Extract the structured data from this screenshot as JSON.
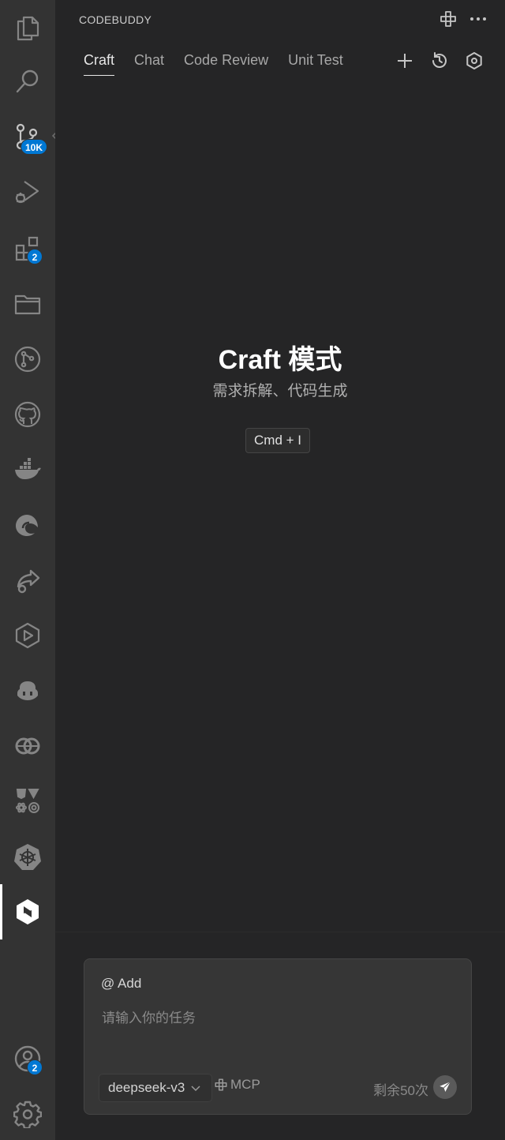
{
  "activity_bar": {
    "items": [
      {
        "name": "explorer",
        "icon": "files-icon"
      },
      {
        "name": "search",
        "icon": "search-icon"
      },
      {
        "name": "source-control",
        "icon": "source-control-icon",
        "badge": "10K"
      },
      {
        "name": "run-debug",
        "icon": "run-debug-icon"
      },
      {
        "name": "extensions",
        "icon": "extensions-icon",
        "badge": "2"
      },
      {
        "name": "folders",
        "icon": "folder-icon"
      },
      {
        "name": "git-graph",
        "icon": "git-graph-icon"
      },
      {
        "name": "github",
        "icon": "github-icon"
      },
      {
        "name": "docker",
        "icon": "docker-icon"
      },
      {
        "name": "edge",
        "icon": "edge-icon"
      },
      {
        "name": "live-share",
        "icon": "live-share-icon"
      },
      {
        "name": "play",
        "icon": "play-icon"
      },
      {
        "name": "copilot",
        "icon": "copilot-icon"
      },
      {
        "name": "remote",
        "icon": "remote-icon"
      },
      {
        "name": "frameworks",
        "icon": "frameworks-icon"
      },
      {
        "name": "kubernetes",
        "icon": "kubernetes-icon"
      },
      {
        "name": "codebuddy",
        "icon": "codebuddy-icon",
        "active": true
      }
    ],
    "account_badge": "2"
  },
  "panel": {
    "title": "CODEBUDDY",
    "tabs": [
      {
        "label": "Craft",
        "active": true
      },
      {
        "label": "Chat"
      },
      {
        "label": "Code Review"
      },
      {
        "label": "Unit Test"
      }
    ]
  },
  "hero": {
    "title": "Craft 模式",
    "subtitle": "需求拆解、代码生成",
    "shortcut": "Cmd + I"
  },
  "input": {
    "add_label": "@ Add",
    "placeholder": "请输入你的任务",
    "model": "deepseek-v3",
    "mcp_label": "MCP",
    "remaining": "剩余50次"
  },
  "colors": {
    "badge": "#0078d4",
    "activity_bar": "#333333",
    "panel": "#252526"
  }
}
